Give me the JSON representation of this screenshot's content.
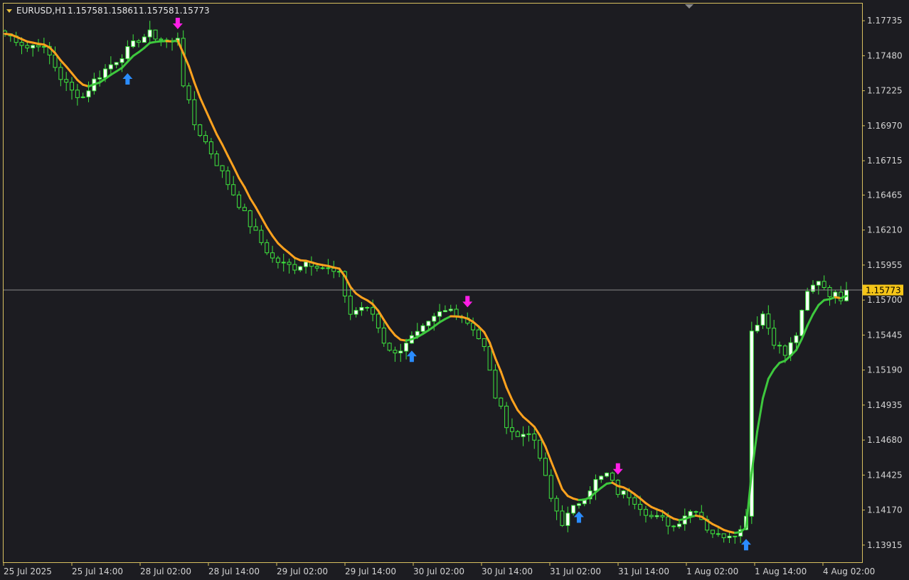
{
  "chart_data": {
    "type": "candlestick",
    "title": "EURUSD,H1",
    "ohlc": [
      "1.15758",
      "1.15861",
      "1.15758",
      "1.15773"
    ],
    "current_price": "1.15773",
    "ylim": [
      1.1379,
      1.1786
    ],
    "y_ticks": [
      "1.17735",
      "1.17480",
      "1.17225",
      "1.16970",
      "1.16715",
      "1.16465",
      "1.16210",
      "1.15955",
      "1.15700",
      "1.15445",
      "1.15190",
      "1.14935",
      "1.14680",
      "1.14425",
      "1.14170",
      "1.13915"
    ],
    "x_ticks": [
      "25 Jul 2025",
      "25 Jul 14:00",
      "28 Jul 02:00",
      "28 Jul 14:00",
      "29 Jul 02:00",
      "29 Jul 14:00",
      "30 Jul 02:00",
      "30 Jul 14:00",
      "31 Jul 02:00",
      "31 Jul 14:00",
      "1 Aug 02:00",
      "1 Aug 14:00",
      "4 Aug 02:00"
    ],
    "signals": [
      {
        "type": "buy",
        "bar": 22
      },
      {
        "type": "sell",
        "bar": 31
      },
      {
        "type": "buy",
        "bar": 73
      },
      {
        "type": "sell",
        "bar": 83
      },
      {
        "type": "buy",
        "bar": 103
      },
      {
        "type": "sell",
        "bar": 110
      },
      {
        "type": "buy",
        "bar": 133
      }
    ],
    "colors": {
      "background": "#1c1c21",
      "frame": "#d8c060",
      "bull_body": "#ffffff",
      "bear_body": "#1c1c21",
      "wick": "#3ee63e",
      "trend_down": "#ffa21e",
      "trend_up": "#3ec83e",
      "buy_arrow": "#2a8cff",
      "sell_arrow": "#ff1ee6",
      "price_label_bg": "#f5c518",
      "price_line": "#8a8a8a"
    }
  }
}
